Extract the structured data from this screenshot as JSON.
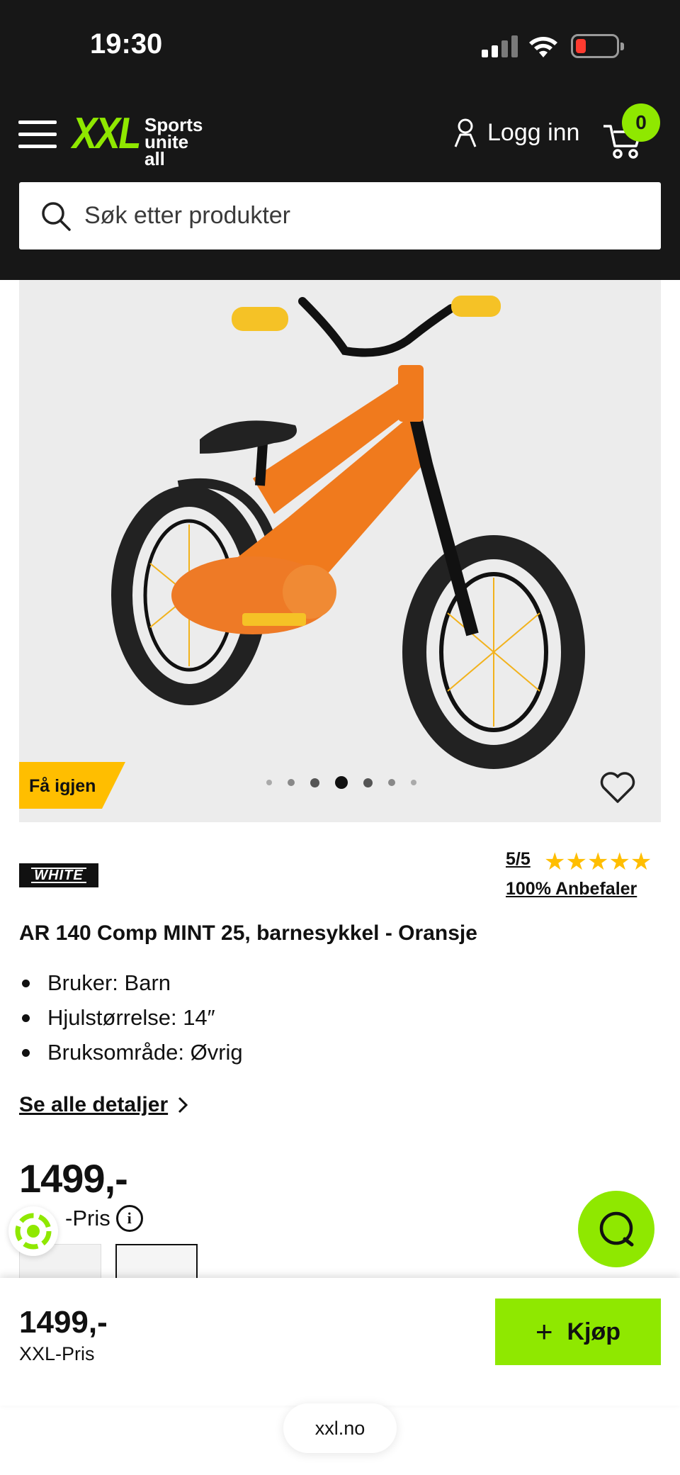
{
  "status_bar": {
    "time": "19:30"
  },
  "header": {
    "logo_text": "XXL",
    "tagline_line1": "Sports",
    "tagline_line2": "unite all",
    "login_label": "Logg inn",
    "cart_count": "0",
    "search_placeholder": "Søk etter produkter"
  },
  "product": {
    "badge": "Få igjen",
    "image_dots": {
      "count": 7,
      "active_index": 3
    },
    "brand": "WHITE",
    "rating_score": "5/5",
    "rating_stars": 5,
    "stars_text": "★★★★★",
    "recommend": "100% Anbefaler",
    "title": "AR 140 Comp MINT 25, barnesykkel - Oransje",
    "features": [
      "Bruker: Barn",
      "Hjulstørrelse: 14″",
      "Bruksområde: Øvrig"
    ],
    "details_link": "Se alle detaljer",
    "price": "1499,-",
    "price_label": "-Pris"
  },
  "buy_bar": {
    "price": "1499,-",
    "price_label": "XXL-Pris",
    "buy_button": "Kjøp"
  },
  "browser": {
    "url": "xxl.no"
  },
  "colors": {
    "accent": "#8fe800",
    "header_bg": "#171717",
    "badge": "#ffbe00",
    "star": "#ffbe00"
  }
}
